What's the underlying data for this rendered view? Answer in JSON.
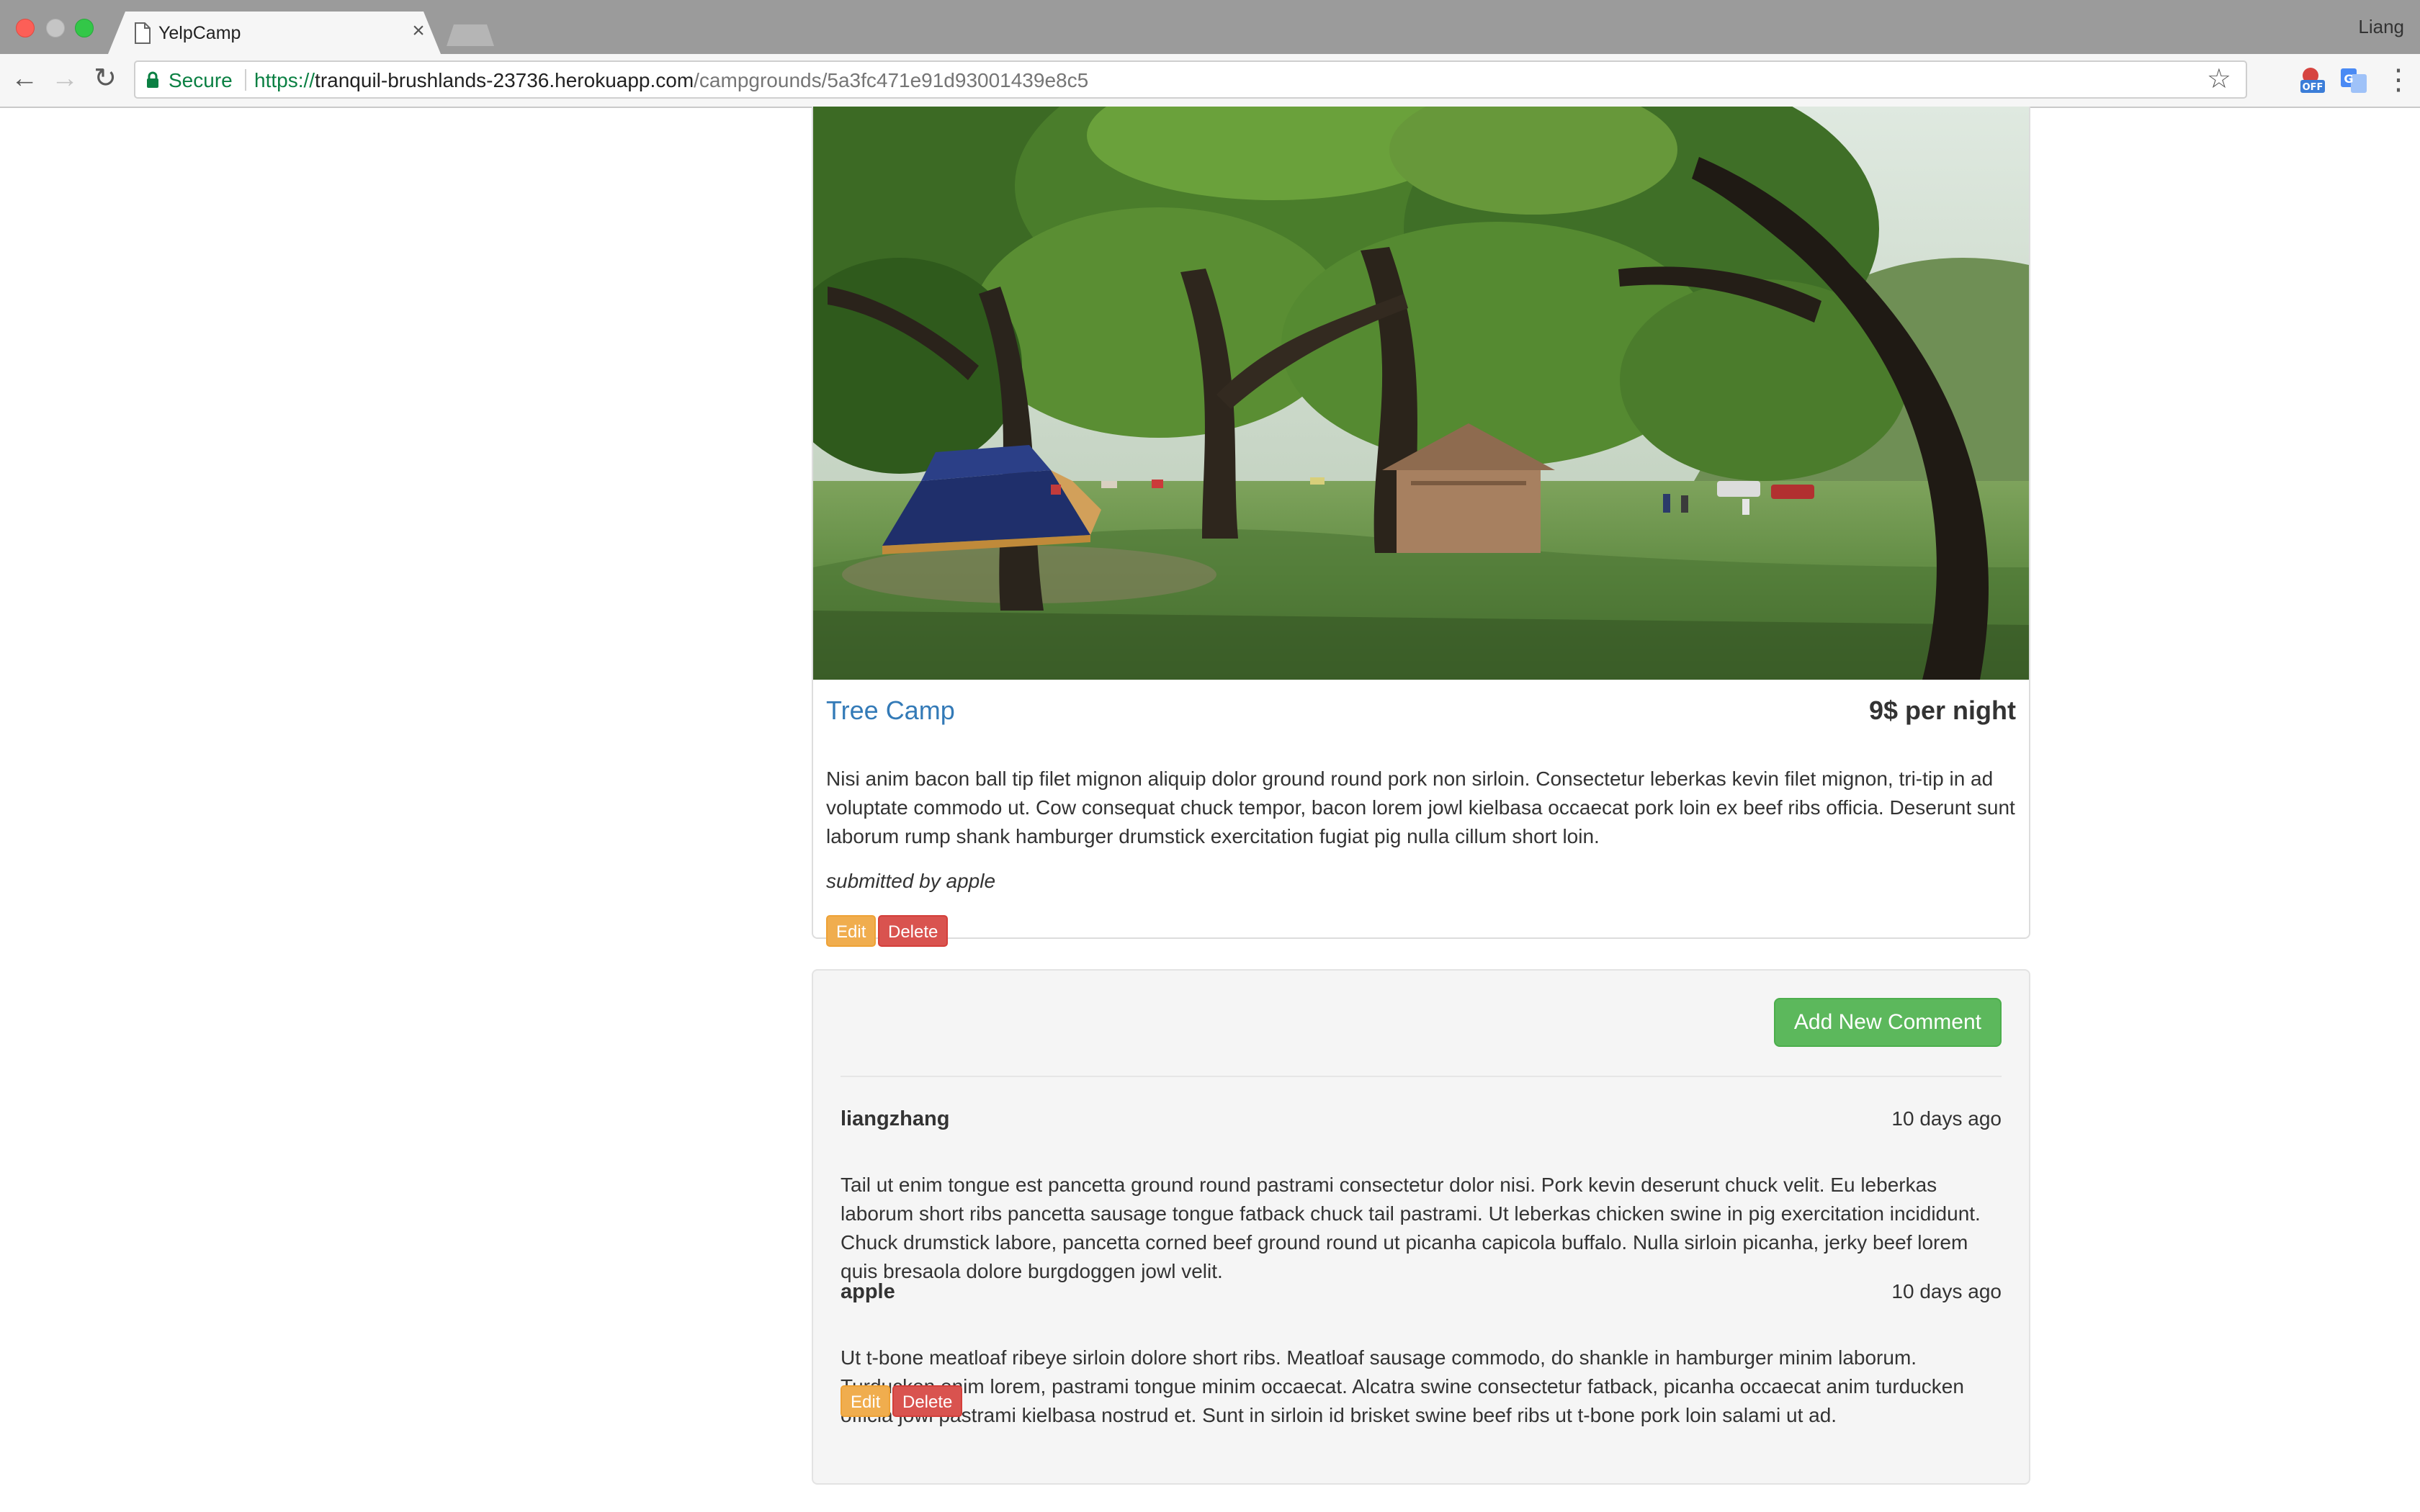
{
  "browser": {
    "tab_title": "YelpCamp",
    "profile_name": "Liang",
    "secure_label": "Secure",
    "url_scheme": "https://",
    "url_host": "tranquil-brushlands-23736.herokuapp.com",
    "url_path": "/campgrounds/5a3fc471e91d93001439e8c5",
    "icons": [
      "document-icon",
      "close-icon",
      "back-arrow-icon",
      "forward-arrow-icon",
      "reload-icon",
      "lock-icon",
      "star-icon",
      "extension-off-icon",
      "translate-icon",
      "kebab-menu-icon"
    ]
  },
  "campground": {
    "name": "Tree Camp",
    "price": "9$ per night",
    "description": "Nisi anim bacon ball tip filet mignon aliquip dolor ground round pork non sirloin. Consectetur leberkas kevin filet mignon, tri-tip in ad voluptate commodo ut. Cow consequat chuck tempor, bacon lorem jowl kielbasa occaecat pork loin ex beef ribs officia. Deserunt sunt laborum rump shank hamburger drumstick exercitation fugiat pig nulla cillum short loin.",
    "submitted_by": "submitted by apple",
    "edit_label": "Edit",
    "delete_label": "Delete"
  },
  "comments_section": {
    "add_button_label": "Add New Comment",
    "comments": [
      {
        "author": "liangzhang",
        "time": "10 days ago",
        "text": "Tail ut enim tongue est pancetta ground round pastrami consectetur dolor nisi. Pork kevin deserunt chuck velit. Eu leberkas laborum short ribs pancetta sausage tongue fatback chuck tail pastrami. Ut leberkas chicken swine in pig exercitation incididunt. Chuck drumstick labore, pancetta corned beef ground round ut picanha capicola buffalo. Nulla sirloin picanha, jerky beef lorem quis bresaola dolore burgdoggen jowl velit."
      },
      {
        "author": "apple",
        "time": "10 days ago",
        "text": "Ut t-bone meatloaf ribeye sirloin dolore short ribs. Meatloaf sausage commodo, do shankle in hamburger minim laborum. Turducken enim lorem, pastrami tongue minim occaecat. Alcatra swine consectetur fatback, picanha occaecat anim turducken officia jowl pastrami kielbasa nostrud et. Sunt in sirloin id brisket swine beef ribs ut t-bone pork loin salami ut ad.",
        "edit_label": "Edit",
        "delete_label": "Delete"
      }
    ]
  },
  "colors": {
    "link_blue": "#337ab7",
    "success_green": "#5cb85c",
    "warning_orange": "#f0ad4e",
    "danger_red": "#d9534f",
    "secure_green": "#0b8043"
  }
}
